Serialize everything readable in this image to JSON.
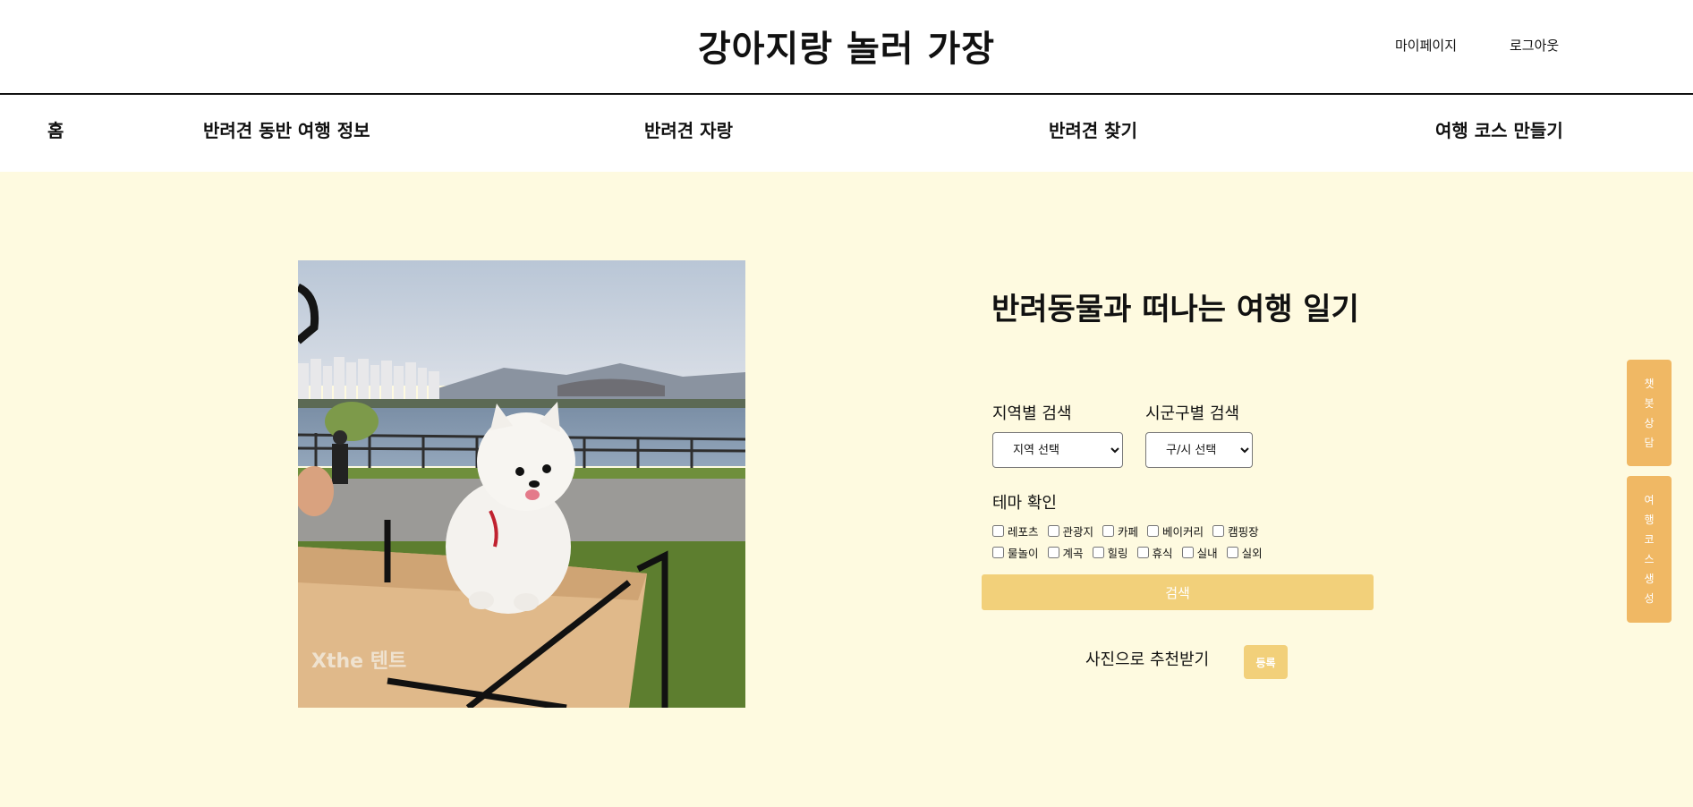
{
  "header": {
    "title": "강아지랑 놀러 가장",
    "mypage": "마이페이지",
    "logout": "로그아웃"
  },
  "nav": {
    "home": "홈",
    "travel_info": "반려견 동반 여행 정보",
    "pet_boast": "반려견 자랑",
    "find_pet": "반려견 찾기",
    "make_course": "여행 코스 만들기"
  },
  "main": {
    "title": "반려동물과 떠나는 여행 일기",
    "region_label": "지역별 검색",
    "region_select": "지역 선택",
    "district_label": "시군구별 검색",
    "district_select": "구/시 선택",
    "theme_label": "테마 확인",
    "themes_row1": [
      "레포츠",
      "관광지",
      "카페",
      "베이커리",
      "캠핑장"
    ],
    "themes_row2": [
      "물놀이",
      "계곡",
      "힐링",
      "휴식",
      "실내",
      "실외"
    ],
    "search_button": "검색",
    "photo_rec_label": "사진으로 추천받기",
    "register_button": "등록"
  },
  "side": {
    "chatbot": [
      "챗",
      "봇",
      "상",
      "담"
    ],
    "course": [
      "여",
      "행",
      "코",
      "스",
      "생",
      "성"
    ]
  },
  "colors": {
    "background": "#fefae0",
    "accent": "#f2d07a",
    "side_button": "#f0b864"
  },
  "icons": {
    "select_arrow": "chevron-down-icon"
  }
}
